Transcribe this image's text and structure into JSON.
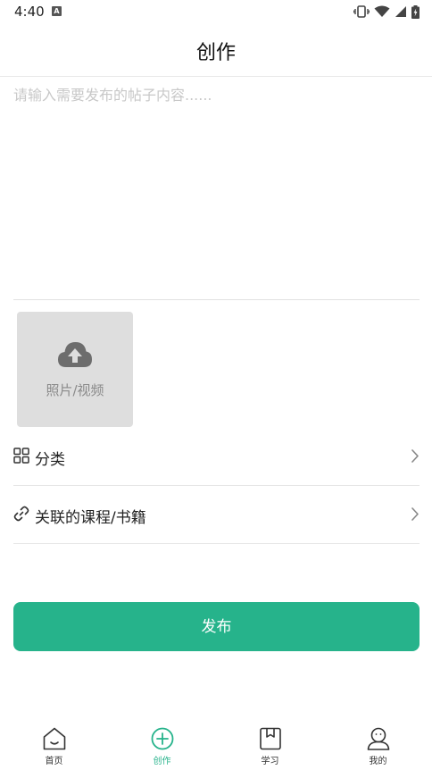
{
  "status_bar": {
    "time": "4:40",
    "notification_badge": "A",
    "icons": [
      "vibrate-icon",
      "wifi-icon",
      "signal-icon",
      "battery-icon"
    ]
  },
  "header": {
    "title": "创作"
  },
  "content": {
    "placeholder": "请输入需要发布的帖子内容......",
    "value": ""
  },
  "upload": {
    "label": "照片/视频",
    "icon": "cloud-upload-icon"
  },
  "rows": {
    "category": {
      "label": "分类",
      "icon": "grid-icon"
    },
    "related": {
      "label": "关联的课程/书籍",
      "icon": "link-icon"
    }
  },
  "publish": {
    "label": "发布"
  },
  "bottom_nav": {
    "items": [
      {
        "label": "首页",
        "icon": "home-icon",
        "active": false
      },
      {
        "label": "创作",
        "icon": "create-icon",
        "active": true
      },
      {
        "label": "学习",
        "icon": "bookmark-icon",
        "active": false
      },
      {
        "label": "我的",
        "icon": "profile-icon",
        "active": false
      }
    ]
  },
  "colors": {
    "accent": "#26b38b",
    "placeholder": "#c8c8c8",
    "upload_bg": "#dedede"
  }
}
